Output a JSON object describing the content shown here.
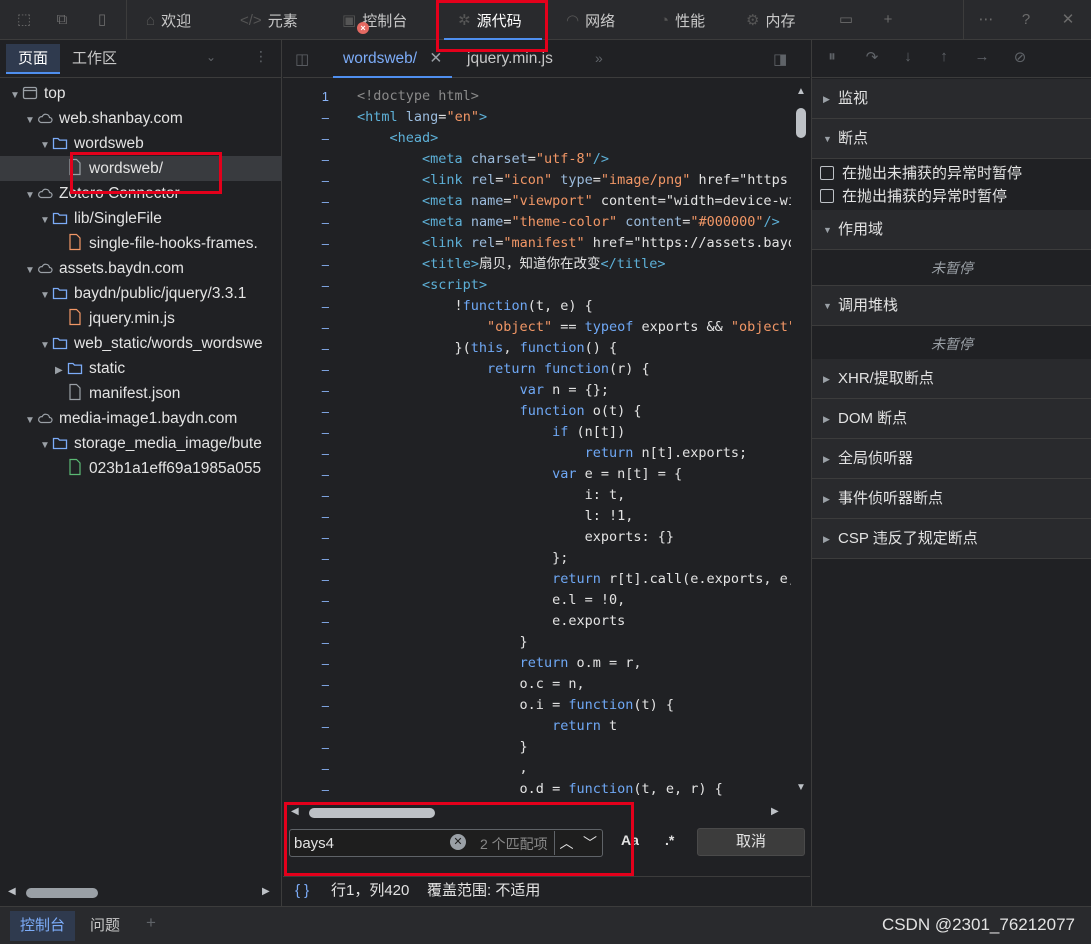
{
  "top_tabs": [
    {
      "label": "欢迎",
      "icon": "home-icon"
    },
    {
      "label": "元素",
      "icon": "code-icon"
    },
    {
      "label": "控制台",
      "icon": "console-icon"
    },
    {
      "label": "源代码",
      "icon": "bug-icon"
    },
    {
      "label": "网络",
      "icon": "wifi-icon"
    },
    {
      "label": "性能",
      "icon": "performance-icon"
    },
    {
      "label": "内存",
      "icon": "memory-icon"
    }
  ],
  "console_error_badge": "×",
  "navigator": {
    "tabs": [
      "页面",
      "工作区"
    ],
    "tree": [
      {
        "label": "top",
        "type": "frame"
      },
      {
        "label": "web.shanbay.com",
        "type": "cloud"
      },
      {
        "label": "wordsweb",
        "type": "folder"
      },
      {
        "label": "wordsweb/",
        "type": "file"
      },
      {
        "label": "Zotero Connector",
        "type": "cloud"
      },
      {
        "label": "lib/SingleFile",
        "type": "folder"
      },
      {
        "label": "single-file-hooks-frames.",
        "type": "file-js"
      },
      {
        "label": "assets.baydn.com",
        "type": "cloud"
      },
      {
        "label": "baydn/public/jquery/3.3.1",
        "type": "folder"
      },
      {
        "label": "jquery.min.js",
        "type": "file-js"
      },
      {
        "label": "web_static/words_wordswe",
        "type": "folder"
      },
      {
        "label": "static",
        "type": "folder"
      },
      {
        "label": "manifest.json",
        "type": "file"
      },
      {
        "label": "media-image1.baydn.com",
        "type": "cloud"
      },
      {
        "label": "storage_media_image/bute",
        "type": "folder"
      },
      {
        "label": "023b1a1eff69a1985a055",
        "type": "file-img"
      }
    ]
  },
  "editor": {
    "tabs": [
      "wordsweb/",
      "jquery.min.js"
    ],
    "first_line_number": "1",
    "code_lines": [
      "<!doctype html>",
      "<html lang=\"en\">",
      "    <head>",
      "        <meta charset=\"utf-8\"/>",
      "        <link rel=\"icon\" type=\"image/png\" href=\"https:",
      "        <meta name=\"viewport\" content=\"width=device-wi",
      "        <meta name=\"theme-color\" content=\"#000000\"/>",
      "        <link rel=\"manifest\" href=\"https://assets.baydn",
      "        <title>扇贝，知道你在改变</title>",
      "        <script>",
      "            !function(t, e) {",
      "                \"object\" == typeof exports && \"object\"",
      "            }(this, function() {",
      "                return function(r) {",
      "                    var n = {};",
      "                    function o(t) {",
      "                        if (n[t])",
      "                            return n[t].exports;",
      "                        var e = n[t] = {",
      "                            i: t,",
      "                            l: !1,",
      "                            exports: {}",
      "                        };",
      "                        return r[t].call(e.exports, e,",
      "                        e.l = !0,",
      "                        e.exports",
      "                    }",
      "                    return o.m = r,",
      "                    o.c = n,",
      "                    o.i = function(t) {",
      "                        return t",
      "                    }",
      "                    ,",
      "                    o.d = function(t, e, r) {"
    ],
    "search": {
      "value": "bays4",
      "match_count": "2 个匹配项",
      "case_label": "Aa",
      "regex_label": ".*",
      "cancel_label": "取消"
    },
    "status": {
      "pretty_print": "{ }",
      "position": "行1，列420",
      "coverage": "覆盖范围: 不适用"
    }
  },
  "debugger": {
    "sections": [
      {
        "title": "监视",
        "expanded": false
      },
      {
        "title": "断点",
        "expanded": true
      },
      {
        "title": "作用域",
        "expanded": true
      },
      {
        "title": "调用堆栈",
        "expanded": true
      },
      {
        "title": "XHR/提取断点",
        "expanded": false
      },
      {
        "title": "DOM 断点",
        "expanded": false
      },
      {
        "title": "全局侦听器",
        "expanded": false
      },
      {
        "title": "事件侦听器断点",
        "expanded": false
      },
      {
        "title": "CSP 违反了规定断点",
        "expanded": false
      }
    ],
    "breakpoint_options": [
      "在抛出未捕获的异常时暂停",
      "在抛出捕获的异常时暂停"
    ],
    "not_paused": "未暂停"
  },
  "drawer": {
    "tabs": [
      "控制台",
      "问题"
    ],
    "add_label": "+",
    "watermark": "CSDN @2301_76212077"
  },
  "colors": {
    "accent": "#4f8fef",
    "annotation_red": "#e3001b",
    "background": "#202124"
  }
}
